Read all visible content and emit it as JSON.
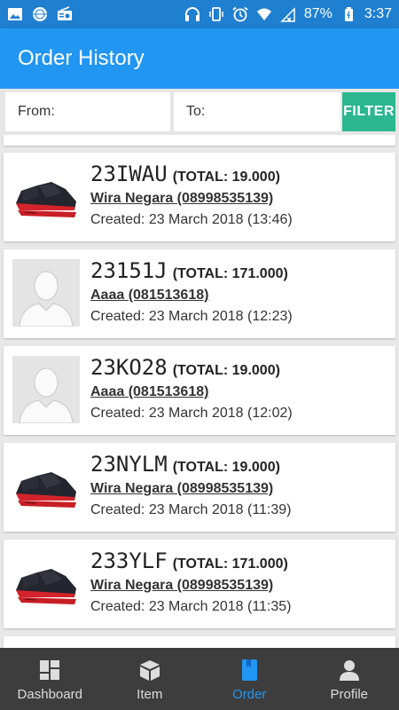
{
  "status_bar": {
    "battery": "87%",
    "time": "3:37",
    "icons": [
      "image-icon",
      "globe-icon",
      "radio-icon",
      "headphones-icon",
      "vibrate-icon",
      "alarm-icon",
      "wifi-icon",
      "no-signal-icon",
      "battery-icon"
    ]
  },
  "app_bar": {
    "title": "Order History"
  },
  "filter": {
    "from_label": "From:",
    "to_label": "To:",
    "button_label": "FILTER",
    "button_color": "#2cb791"
  },
  "orders": [
    {
      "code": "23IWAU",
      "total": "(TOTAL: 19.000)",
      "customer": "Wira Negara (08998535139)",
      "created": "Created: 23 March 2018 (13:46)",
      "thumb": "shoe-icon"
    },
    {
      "code": "23151J",
      "total": "(TOTAL: 171.000)",
      "customer": "Aaaa (081513618)",
      "created": "Created: 23 March 2018 (12:23)",
      "thumb": "avatar-placeholder-icon"
    },
    {
      "code": "23KO28",
      "total": "(TOTAL: 19.000)",
      "customer": "Aaaa (081513618)",
      "created": "Created: 23 March 2018 (12:02)",
      "thumb": "avatar-placeholder-icon"
    },
    {
      "code": "23NYLM",
      "total": "(TOTAL: 19.000)",
      "customer": "Wira Negara (08998535139)",
      "created": "Created: 23 March 2018 (11:39)",
      "thumb": "shoe-icon"
    },
    {
      "code": "233YLF",
      "total": "(TOTAL: 171.000)",
      "customer": "Wira Negara (08998535139)",
      "created": "Created: 23 March 2018 (11:35)",
      "thumb": "shoe-icon"
    }
  ],
  "bottom_nav": {
    "items": [
      {
        "label": "Dashboard",
        "icon": "dashboard-icon"
      },
      {
        "label": "Item",
        "icon": "box-icon"
      },
      {
        "label": "Order",
        "icon": "book-icon"
      },
      {
        "label": "Profile",
        "icon": "person-icon"
      }
    ],
    "active": "Order",
    "active_color": "#2196f3"
  },
  "colors": {
    "app_bar": "#2196f3",
    "status_bar": "#1f7fd1",
    "nav_bg": "#3d3d3d"
  }
}
